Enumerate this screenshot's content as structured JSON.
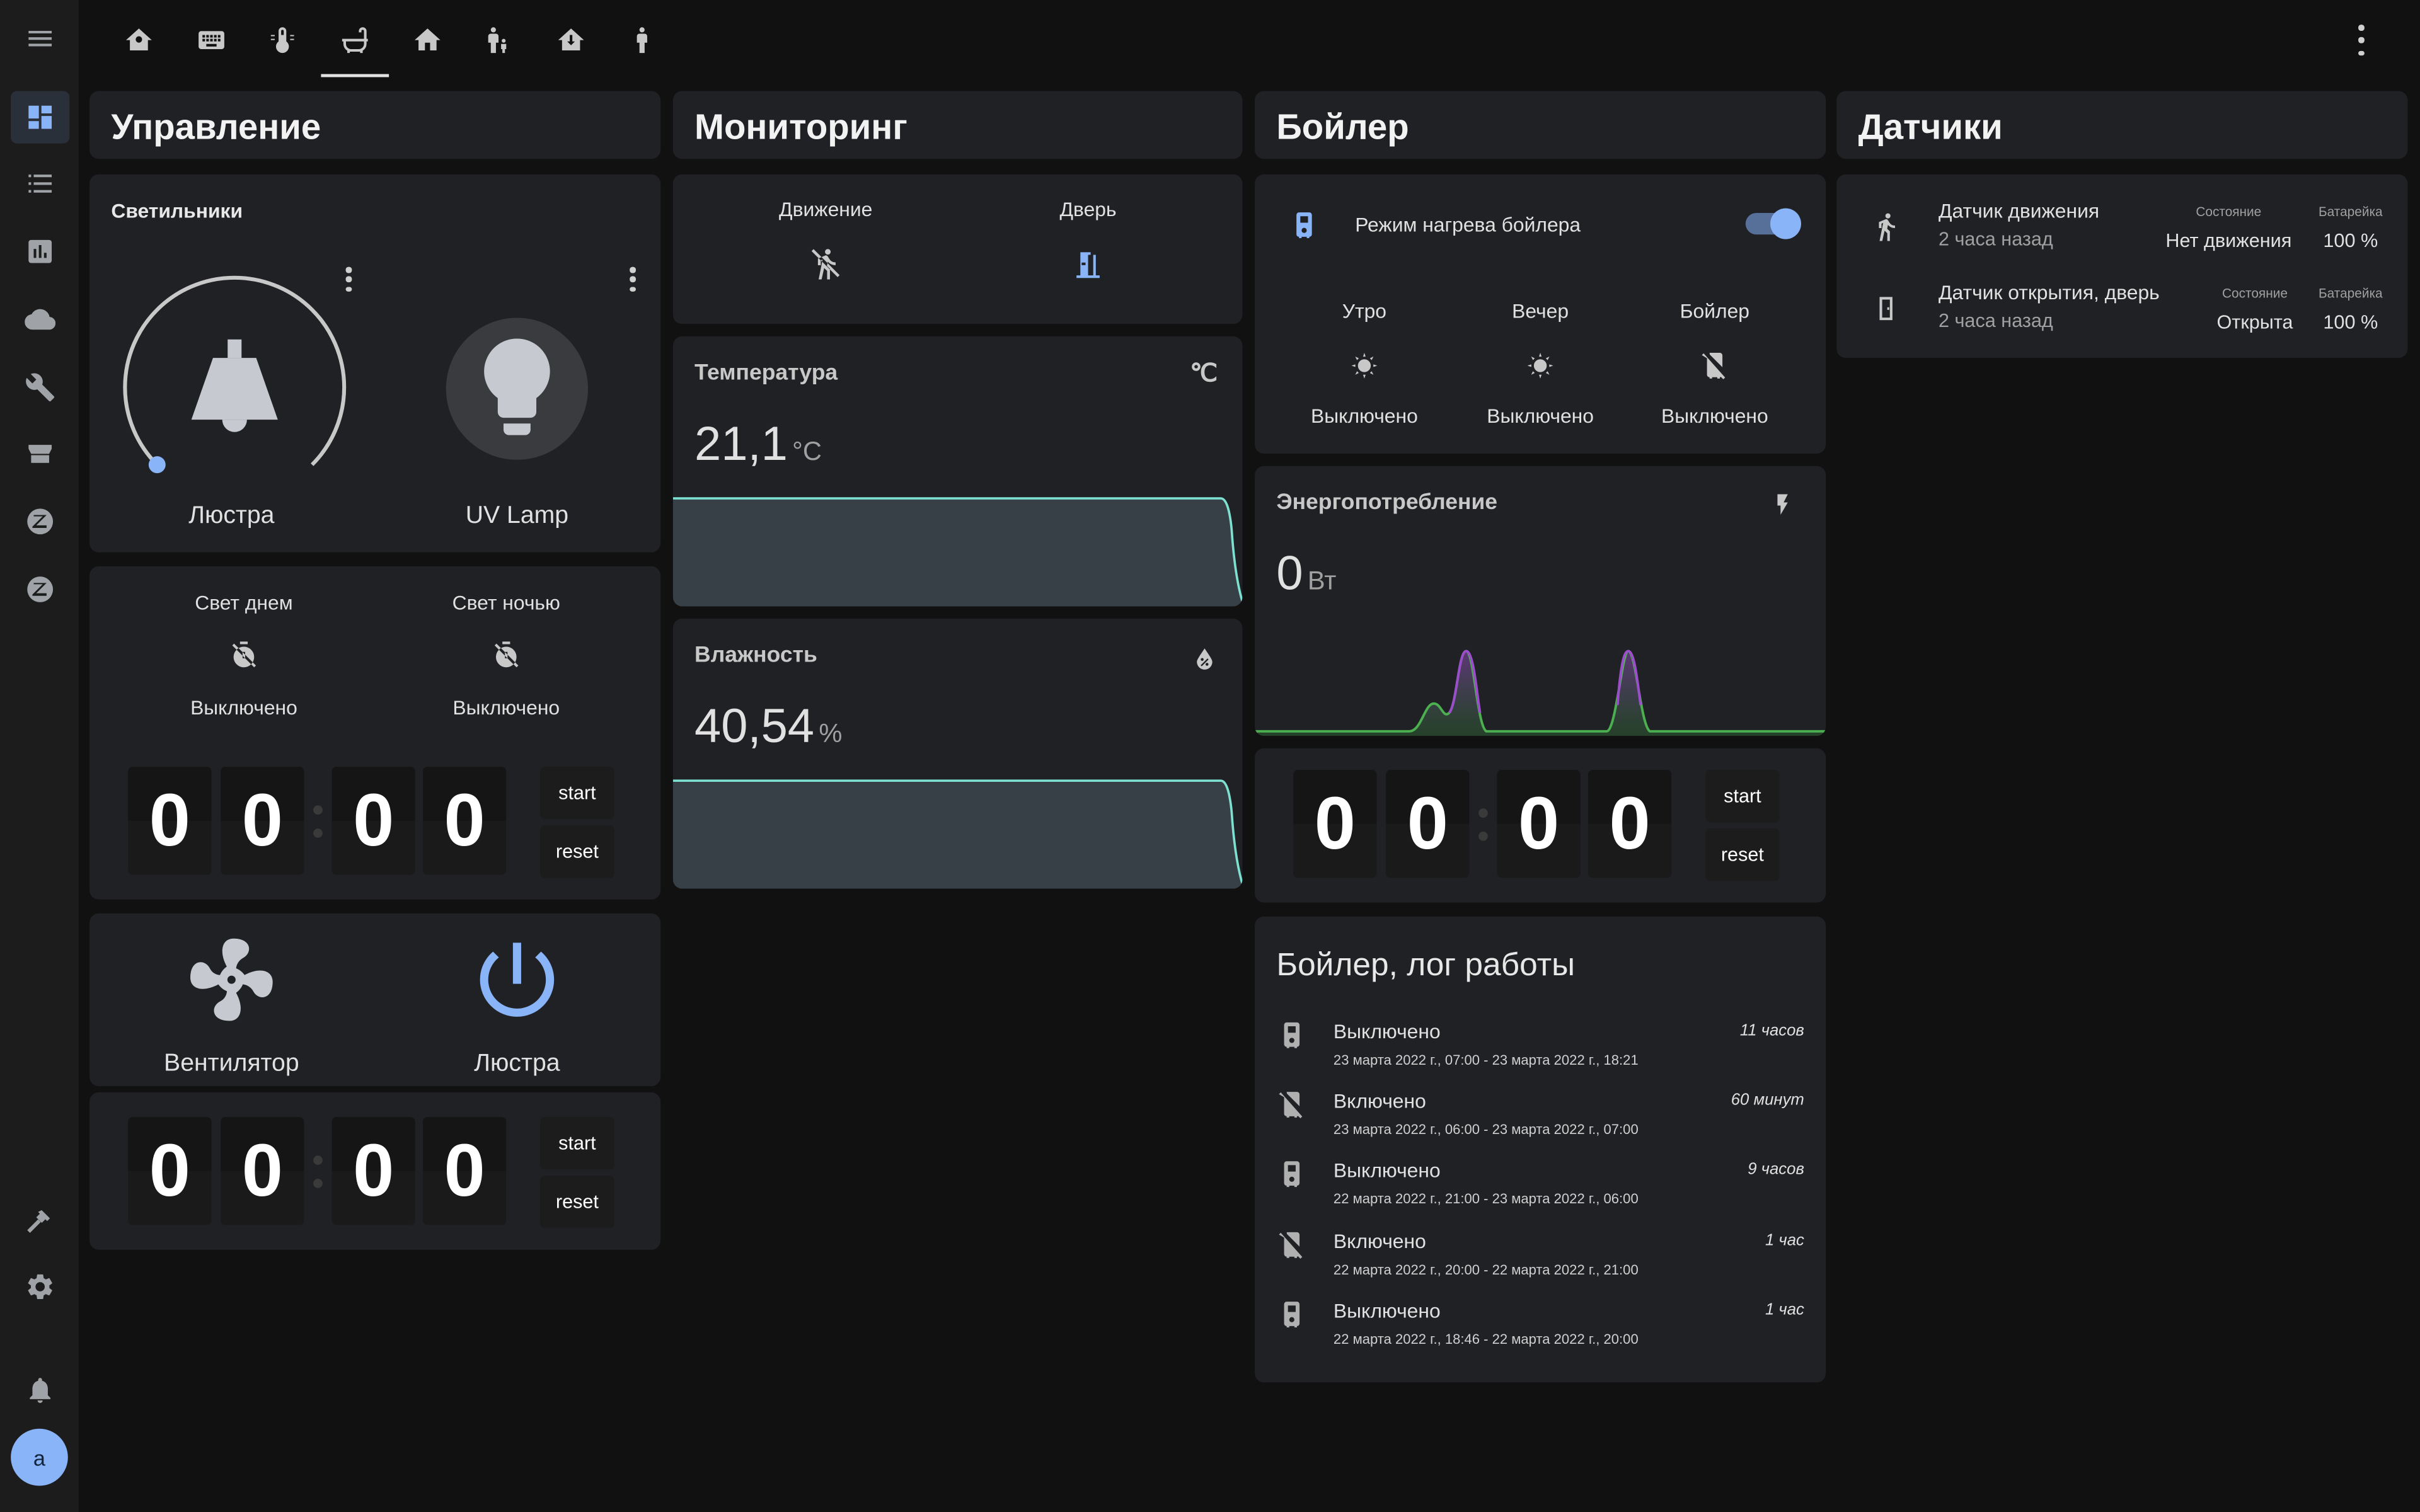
{
  "tabs": [
    "home-outline-icon",
    "keyboard-icon",
    "thermometer-icon",
    "bathtub-icon",
    "home-icon",
    "human-male-child-icon",
    "home-import-icon",
    "human-child-icon"
  ],
  "sidebar": {
    "items": [
      "dashboard-icon",
      "list-icon",
      "chart-icon",
      "cloud-icon",
      "wrench-icon",
      "hacs-icon",
      "zigbee-icon",
      "zigbee2-icon"
    ],
    "bottom": [
      "hammer-icon",
      "gear-icon",
      "bell-icon"
    ],
    "avatar": "a"
  },
  "columns": {
    "control": "Управление",
    "monitoring": "Мониторинг",
    "boiler": "Бойлер",
    "sensors": "Датчики"
  },
  "lights": {
    "header": "Светильники",
    "chandelier": "Люстра",
    "chandelier_brightness_fraction": 0.0,
    "uv": "UV Lamp"
  },
  "light_modes": {
    "day": {
      "label": "Свет днем",
      "state": "Выключено"
    },
    "night": {
      "label": "Свет ночью",
      "state": "Выключено"
    }
  },
  "timer1": {
    "digits": [
      "0",
      "0",
      "0",
      "0"
    ],
    "start": "start",
    "reset": "reset"
  },
  "fan_row": {
    "fan": "Вентилятор",
    "chandelier": "Люстра"
  },
  "timer2": {
    "digits": [
      "0",
      "0",
      "0",
      "0"
    ],
    "start": "start",
    "reset": "reset"
  },
  "monitoring": {
    "motion": "Движение",
    "door": "Дверь",
    "temp": {
      "name": "Температура",
      "value": "21,1",
      "unit": "°C"
    },
    "humidity": {
      "name": "Влажность",
      "value": "40,54",
      "unit": "%"
    }
  },
  "boiler": {
    "mode_label": "Режим нагрева бойлера",
    "mode_on": true,
    "morning": {
      "label": "Утро",
      "state": "Выключено"
    },
    "evening": {
      "label": "Вечер",
      "state": "Выключено"
    },
    "boiler": {
      "label": "Бойлер",
      "state": "Выключено"
    },
    "energy": {
      "name": "Энергопотребление",
      "value": "0",
      "unit": "Вт"
    },
    "timer": {
      "digits": [
        "0",
        "0",
        "0",
        "0"
      ],
      "start": "start",
      "reset": "reset"
    },
    "log_title": "Бойлер, лог работы",
    "log": [
      {
        "state": "Выключено",
        "time": "23 марта 2022 г., 07:00 - 23 марта 2022 г., 18:21",
        "duration": "11 часов",
        "icon": "water-boiler-icon"
      },
      {
        "state": "Включено",
        "time": "23 марта 2022 г., 06:00 - 23 марта 2022 г., 07:00",
        "duration": "60 минут",
        "icon": "water-boiler-off-icon"
      },
      {
        "state": "Выключено",
        "time": "22 марта 2022 г., 21:00 - 23 марта 2022 г., 06:00",
        "duration": "9 часов",
        "icon": "water-boiler-icon"
      },
      {
        "state": "Включено",
        "time": "22 марта 2022 г., 20:00 - 22 марта 2022 г., 21:00",
        "duration": "1 час",
        "icon": "water-boiler-off-icon"
      },
      {
        "state": "Выключено",
        "time": "22 марта 2022 г., 18:46 - 22 марта 2022 г., 20:00",
        "duration": "1 час",
        "icon": "water-boiler-icon"
      }
    ]
  },
  "sensors": [
    {
      "name": "Датчик движения",
      "ago": "2 часа назад",
      "state_label": "Состояние",
      "state": "Нет движения",
      "battery_label": "Батарейка",
      "battery": "100 %",
      "icon": "run-icon"
    },
    {
      "name": "Датчик открытия, дверь",
      "ago": "2 часа назад",
      "state_label": "Состояние",
      "state": "Открыта",
      "battery_label": "Батарейка",
      "battery": "100 %",
      "icon": "door-icon"
    }
  ],
  "colors": {
    "accent": "#8ab4f8",
    "card": "#202124",
    "background": "#111111",
    "sidebar": "#1c1c1c",
    "temp_line": "#7ee0d0",
    "energy_green": "#4caf50",
    "energy_purple": "#9c4dcc"
  }
}
